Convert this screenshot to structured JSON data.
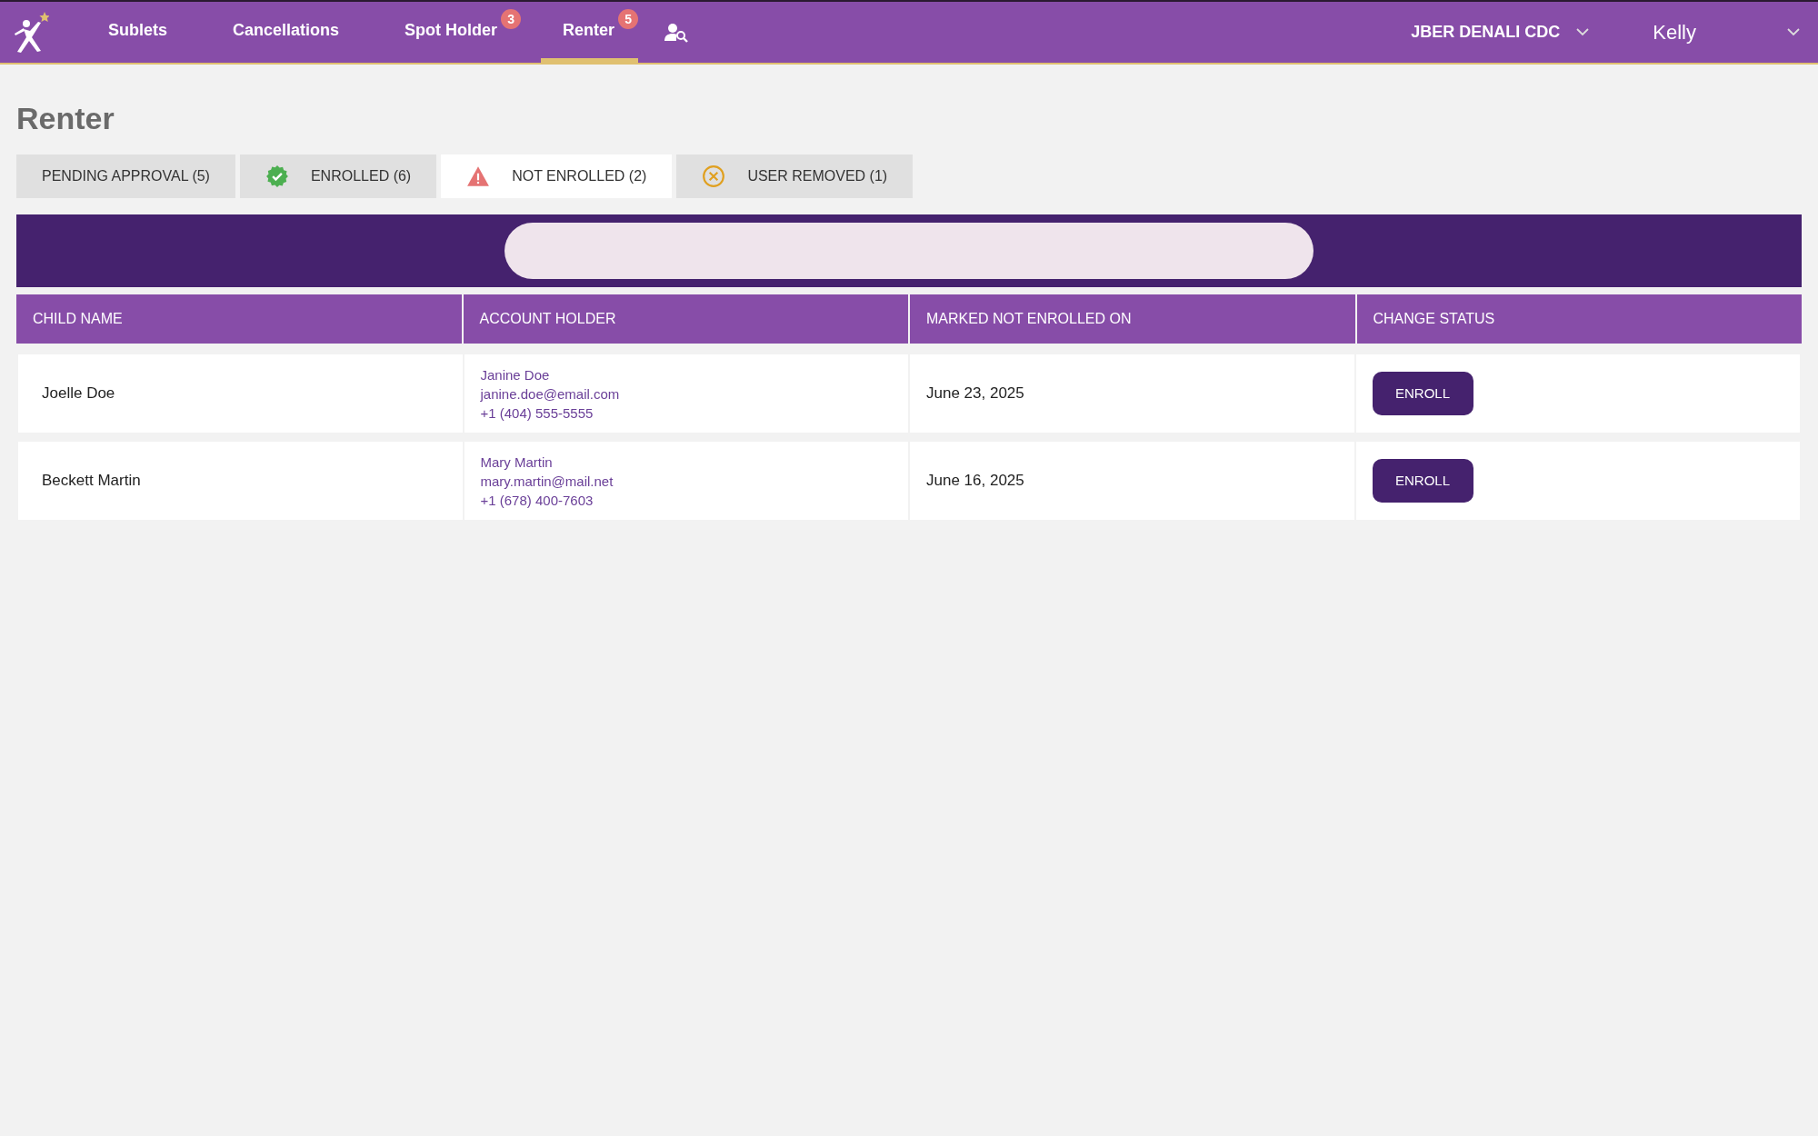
{
  "nav": {
    "items": [
      {
        "label": "Sublets",
        "selected": false
      },
      {
        "label": "Cancellations",
        "selected": false
      },
      {
        "label": "Spot Holder",
        "badge": "3",
        "selected": false
      },
      {
        "label": "Renter",
        "badge": "5",
        "selected": true
      }
    ],
    "center": "JBER DENALI CDC",
    "user": "Kelly"
  },
  "page_title": "Renter",
  "tabs": [
    {
      "label": "PENDING APPROVAL (5)",
      "kind": "none",
      "selected": false
    },
    {
      "label": "ENROLLED (6)",
      "kind": "enrolled",
      "selected": false
    },
    {
      "label": "NOT ENROLLED (2)",
      "kind": "warning",
      "selected": true
    },
    {
      "label": "USER REMOVED (1)",
      "kind": "removed",
      "selected": false
    }
  ],
  "table": {
    "columns": [
      "CHILD NAME",
      "ACCOUNT HOLDER",
      "MARKED NOT ENROLLED ON",
      "CHANGE STATUS"
    ],
    "rows": [
      {
        "child": "Joelle Doe",
        "holder_name": "Janine Doe",
        "holder_email": "janine.doe@email.com",
        "holder_phone": "+1 (404) 555-5555",
        "date": "June 23, 2025",
        "action": "ENROLL"
      },
      {
        "child": "Beckett Martin",
        "holder_name": "Mary Martin",
        "holder_email": "mary.martin@mail.net",
        "holder_phone": "+1 (678) 400-7603",
        "date": "June 16, 2025",
        "action": "ENROLL"
      }
    ]
  }
}
